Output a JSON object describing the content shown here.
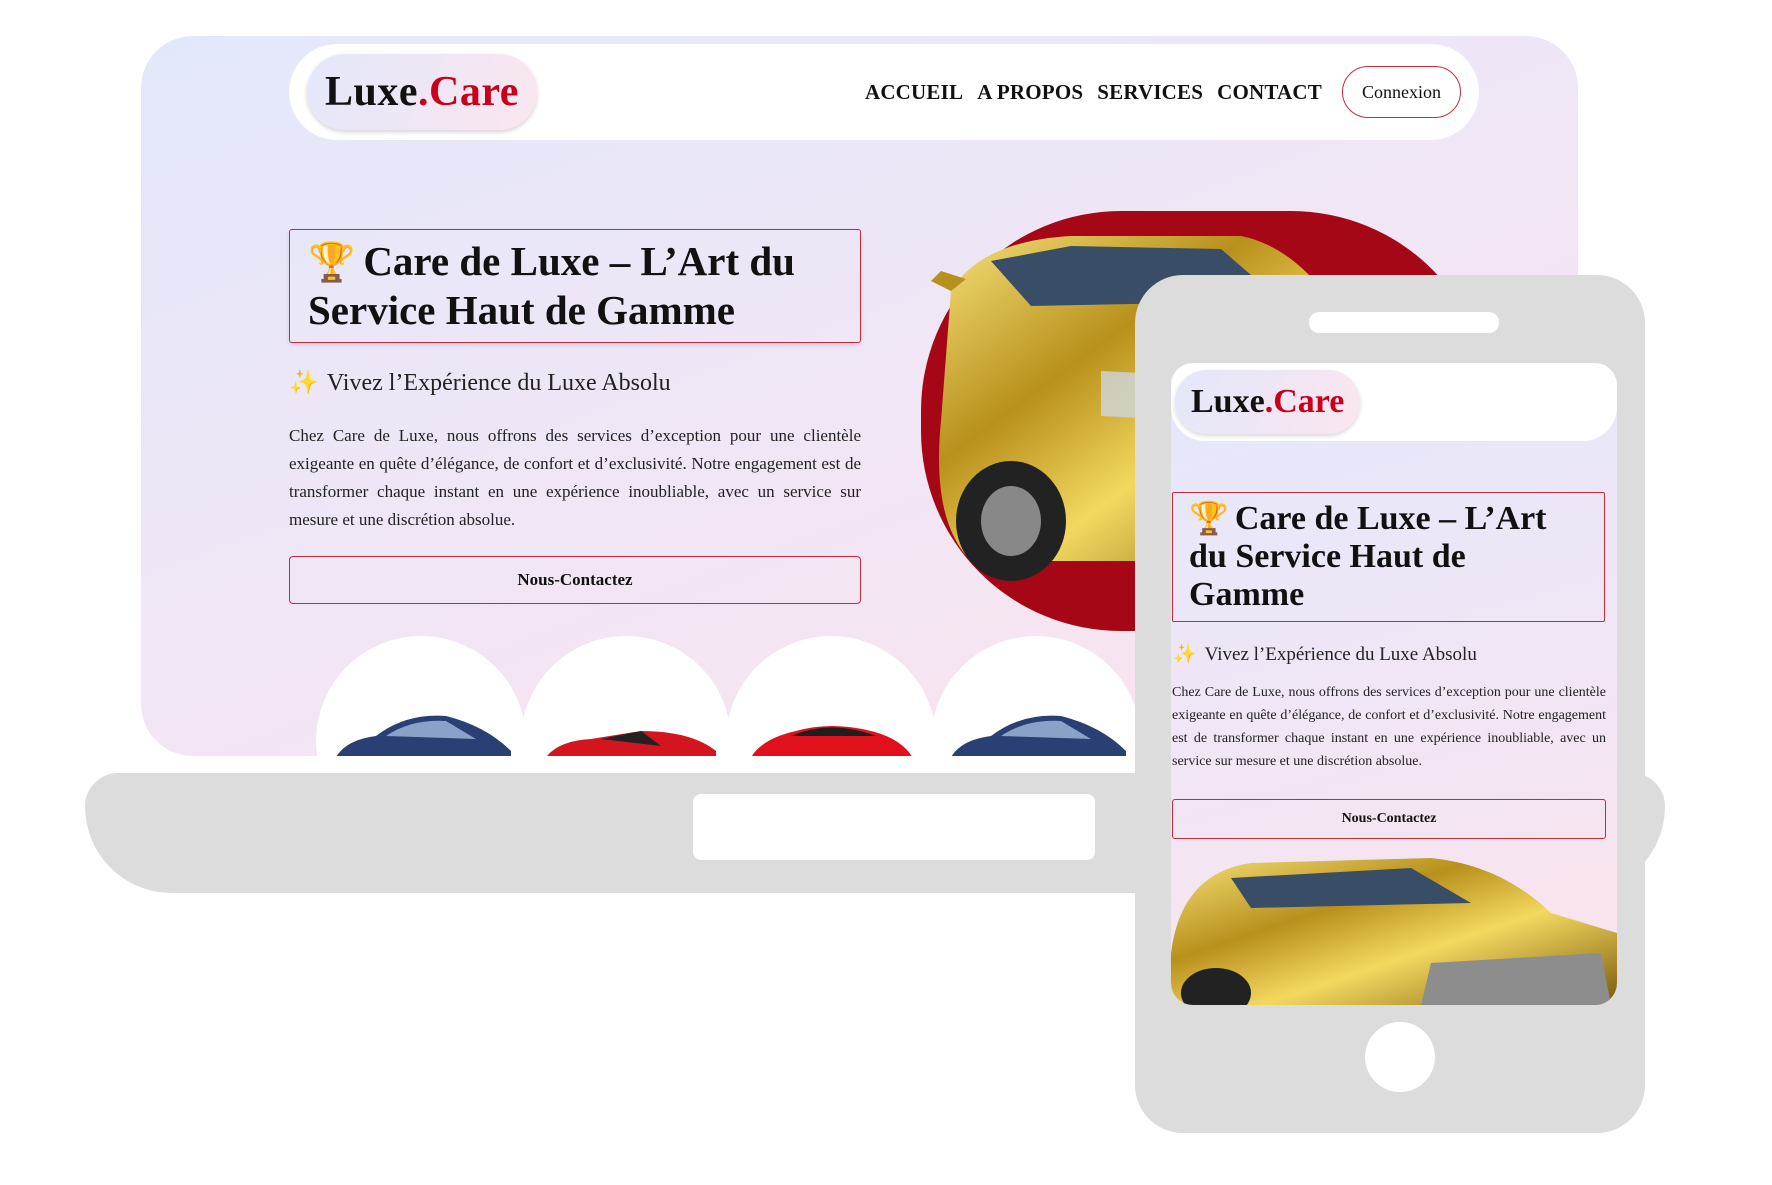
{
  "brand": {
    "name_prefix": "Luxe",
    "name_dot": ".",
    "name_suffix": "Care",
    "accent": "#c8001b"
  },
  "nav": {
    "links": [
      "ACCUEIL",
      "A PROPOS",
      "SERVICES",
      "CONTACT"
    ],
    "login_label": "Connexion"
  },
  "hero": {
    "title": "Care de Luxe – L’Art du Service Haut de Gamme",
    "title_icon": "trophy-icon",
    "subtitle": "Vivez l’Expérience du Luxe Absolu",
    "subtitle_icon": "sparkles-icon",
    "text": "Chez Care de Luxe, nous offrons des services d’exception pour une clientèle exigeante en quête d’élégance, de confort et d’exclusivité. Notre engagement est de transformer chaque instant en une expérience inoubliable, avec un service sur mesure et une discrétion absolue.",
    "cta_label": "Nous-Contactez"
  },
  "colors": {
    "hero_red": "#a50717",
    "gold": "#c9a227",
    "border_red": "#c8283a"
  }
}
